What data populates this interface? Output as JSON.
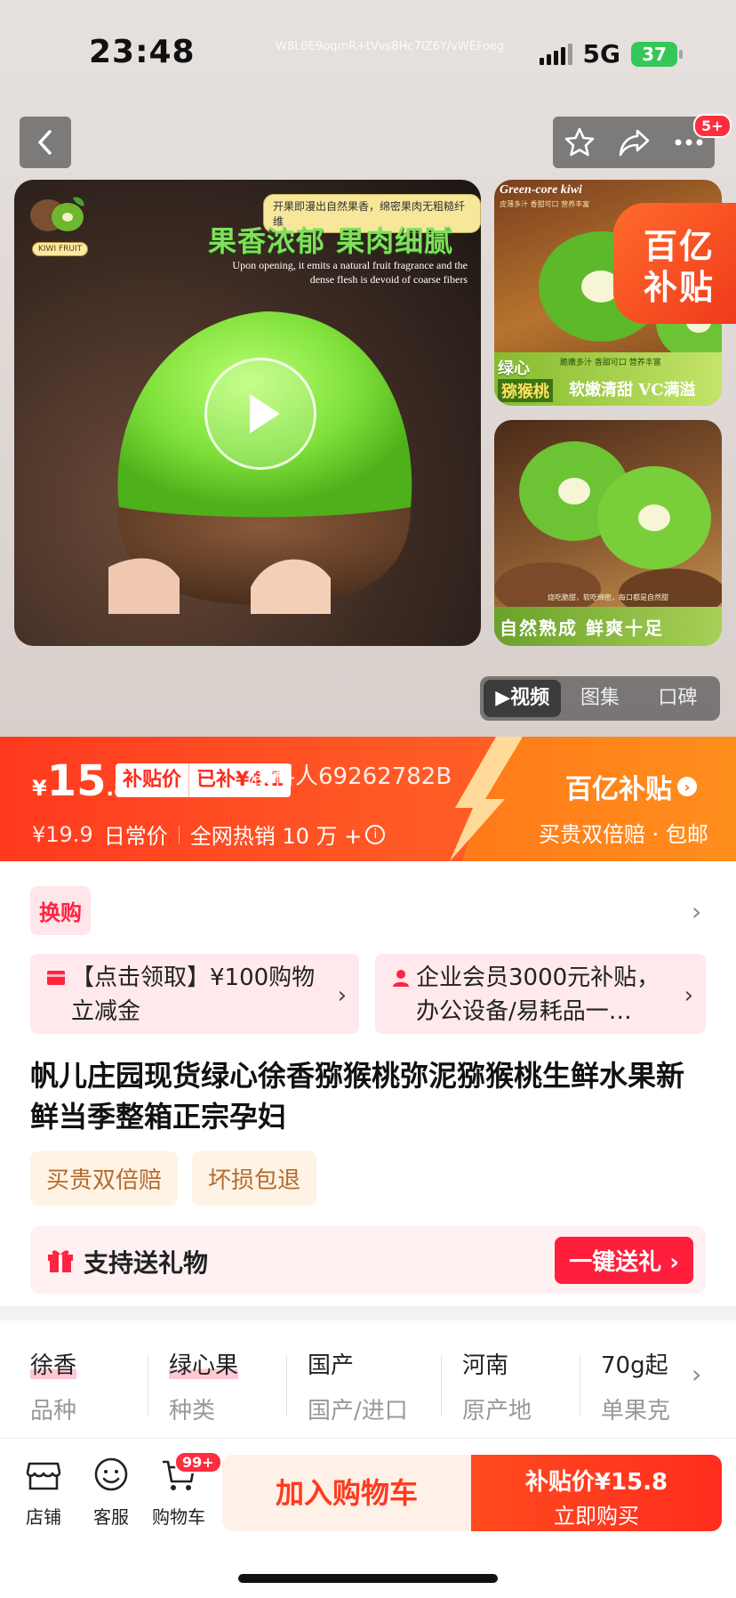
{
  "status_bar": {
    "time": "23:48",
    "network": "5G",
    "battery": "37",
    "watermark": "W8L0E9oqmR+tVvs8Hc7IZ6Y/vWEFoeg"
  },
  "header": {
    "cart_badge": "5+"
  },
  "gallery": {
    "main_tagline": "开果即漫出自然果香，绵密果肉无粗糙纤维",
    "main_headline": "果香浓郁 果肉细腻",
    "main_english": "Upon opening, it emits a natural fruit fragrance  and the dense flesh is devoid of coarse fibers",
    "logo_label": "KIWI FRUIT",
    "side1_title": "Green-core kiwi",
    "side1_small": "皮薄多汁 香甜可口 营养丰富",
    "side1_tag_a": "绿心",
    "side1_tag_b": "猕猴桃",
    "side1_slogan": "软嫩清甜 VC满溢",
    "side1_sub": "脆嫩多汁  香甜可口  营养丰富",
    "side2_small": "烧吃脆甜，软吃绵密，每口都是自然甜",
    "side2_slogan": "自然熟成 鲜爽十足",
    "badge_l1": "百亿",
    "badge_l2": "补贴",
    "tabs": [
      {
        "label": "视频",
        "active": true
      },
      {
        "label": "图集"
      },
      {
        "label": "口碑"
      }
    ]
  },
  "price": {
    "currency": "¥",
    "integer": "15",
    "decimal": ".8",
    "subsidy_label": "补贴价",
    "subsidy_amount": "已补¥4.1",
    "reporter": "爆料人69262782B",
    "original_price": "¥19.9",
    "original_label": "日常价",
    "sales": "全网热销 10 万 +",
    "program_name": "百亿补贴",
    "program_sub": "买贵双倍赔 · 包邮"
  },
  "info": {
    "swap_tag": "换购",
    "coupon1": "【点击领取】¥100购物立减金",
    "coupon2": "企业会员3000元补贴，办公设备/易耗品一…",
    "title": "帆儿庄园现货绿心徐香猕猴桃弥泥猕猴桃生鲜水果新鲜当季整箱正宗孕妇",
    "guarantees": [
      "买贵双倍赔",
      "坏损包退"
    ],
    "gift_label": "支持送礼物",
    "gift_button": "一键送礼"
  },
  "attributes": [
    {
      "value": "徐香",
      "key": "品种"
    },
    {
      "value": "绿心果",
      "key": "种类"
    },
    {
      "value": "国产",
      "key": "国产/进口"
    },
    {
      "value": "河南",
      "key": "原产地"
    },
    {
      "value": "70g起",
      "key": "单果克"
    }
  ],
  "bottom_bar": {
    "store": "店铺",
    "service": "客服",
    "cart": "购物车",
    "cart_badge": "99+",
    "add_cart": "加入购物车",
    "buy_price": "补贴价¥15.8",
    "buy_now": "立即购买"
  },
  "colors": {
    "accent": "#ff2442",
    "banner": "#ff4a1e",
    "subsidy": "#ff7a1a"
  }
}
